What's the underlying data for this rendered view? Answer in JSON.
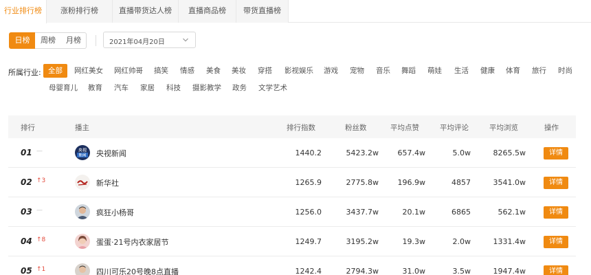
{
  "tabs": [
    {
      "label": "行业排行榜",
      "active": true
    },
    {
      "label": "涨粉排行榜",
      "active": false
    },
    {
      "label": "直播带货达人榜",
      "active": false
    },
    {
      "label": "直播商品榜",
      "active": false
    },
    {
      "label": "带货直播榜",
      "active": false
    }
  ],
  "period": {
    "options": [
      "日榜",
      "周榜",
      "月榜"
    ],
    "selected": "日榜"
  },
  "date": {
    "value": "2021年04月20日"
  },
  "industry": {
    "label": "所属行业:",
    "selected": "全部",
    "options": [
      "全部",
      "网红美女",
      "网红帅哥",
      "搞笑",
      "情感",
      "美食",
      "美妆",
      "穿搭",
      "影视娱乐",
      "游戏",
      "宠物",
      "音乐",
      "舞蹈",
      "萌娃",
      "生活",
      "健康",
      "体育",
      "旅行",
      "时尚",
      "母婴育儿",
      "教育",
      "汽车",
      "家居",
      "科技",
      "摄影教学",
      "政务",
      "文学艺术"
    ]
  },
  "table": {
    "headers": [
      "排行",
      "播主",
      "排行指数",
      "粉丝数",
      "平均点赞",
      "平均评论",
      "平均浏览",
      "操作"
    ],
    "action_label": "详情",
    "rows": [
      {
        "rank": "01",
        "change": "—",
        "change_dir": "none",
        "name": "央视新闻",
        "avatar": "cctv",
        "index": "1440.2",
        "fans": "5423.2w",
        "likes": "657.4w",
        "comments": "5.0w",
        "views": "8265.5w"
      },
      {
        "rank": "02",
        "change": "3",
        "change_dir": "up",
        "name": "新华社",
        "avatar": "xinhua",
        "index": "1265.9",
        "fans": "2775.8w",
        "likes": "196.9w",
        "comments": "4857",
        "views": "3541.0w"
      },
      {
        "rank": "03",
        "change": "—",
        "change_dir": "none",
        "name": "疯狂小杨哥",
        "avatar": "person1",
        "index": "1256.0",
        "fans": "3437.7w",
        "likes": "20.1w",
        "comments": "6865",
        "views": "562.1w"
      },
      {
        "rank": "04",
        "change": "8",
        "change_dir": "up",
        "name": "蛋蛋·21号内衣家居节",
        "avatar": "person2",
        "index": "1249.7",
        "fans": "3195.2w",
        "likes": "19.3w",
        "comments": "2.0w",
        "views": "1331.4w"
      },
      {
        "rank": "05",
        "change": "1",
        "change_dir": "up",
        "name": "四川可乐20号晚8点直播",
        "avatar": "person3",
        "index": "1242.4",
        "fans": "2794.3w",
        "likes": "31.0w",
        "comments": "3.5w",
        "views": "1947.4w"
      }
    ]
  },
  "colors": {
    "accent": "#f08a11",
    "up": "#e34a3c"
  }
}
